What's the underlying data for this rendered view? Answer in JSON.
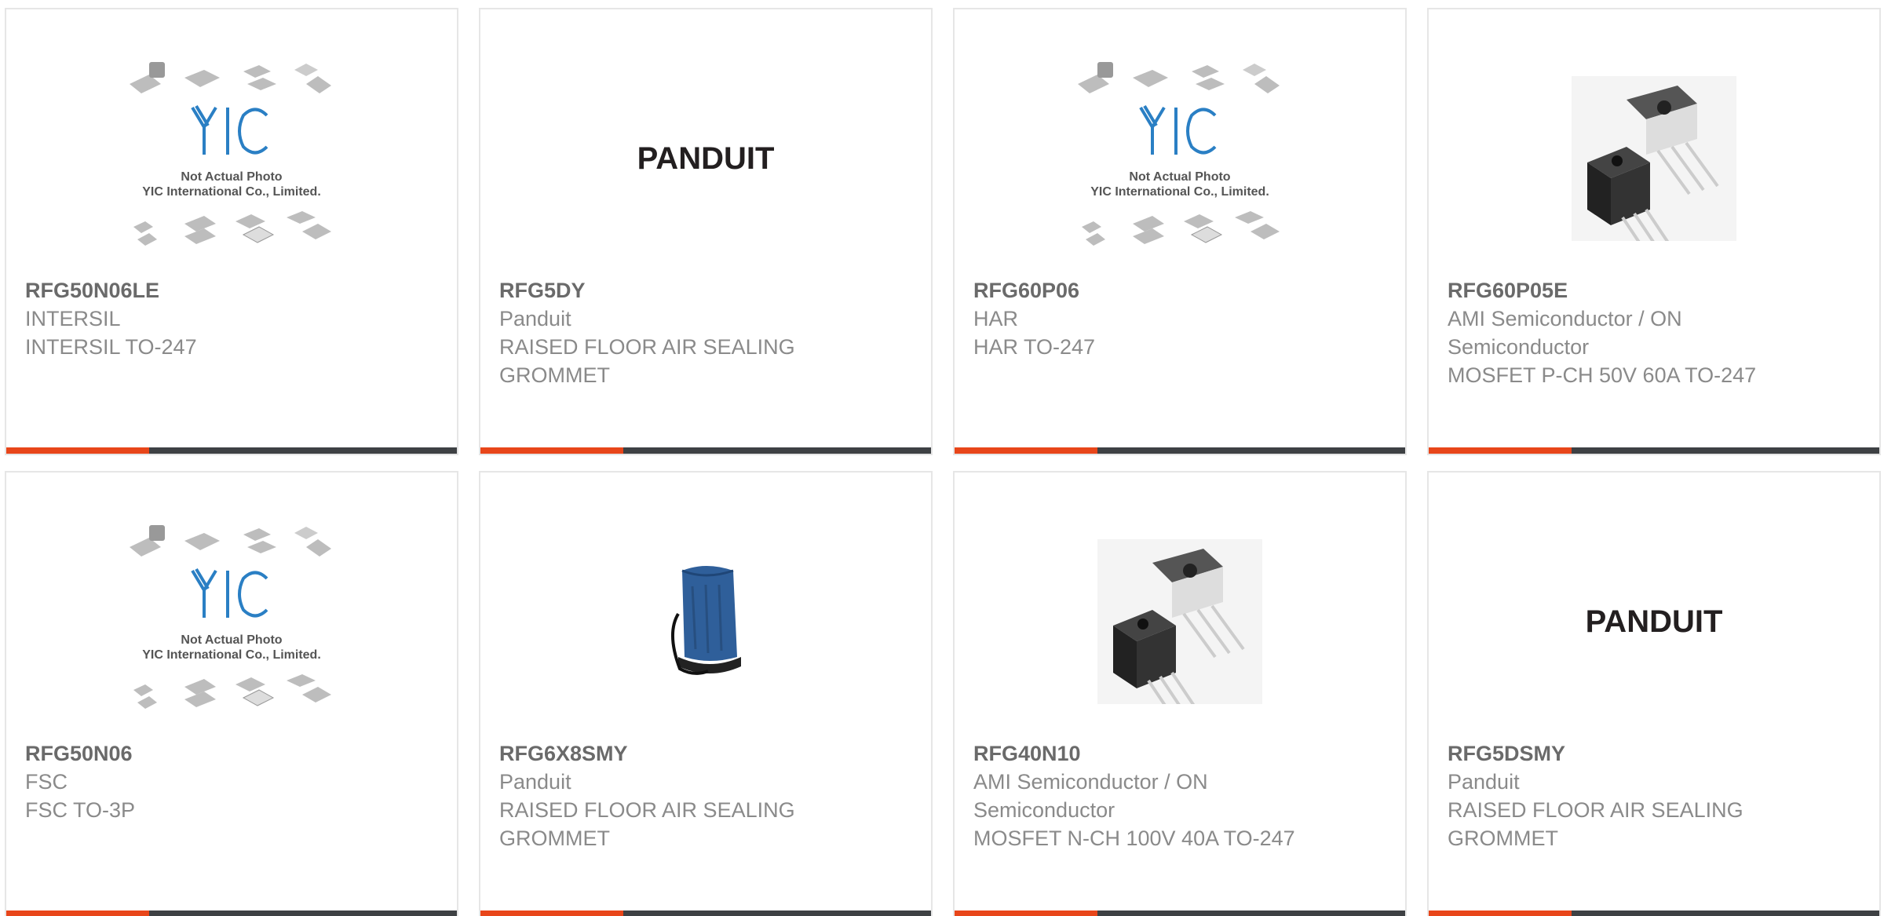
{
  "products": [
    {
      "part_number": "RFG50N06LE",
      "manufacturer": "INTERSIL",
      "description": "INTERSIL TO-247",
      "image": "yic-placeholder",
      "image_caption_1": "Not Actual Photo",
      "image_caption_2": "YIC International Co., Limited."
    },
    {
      "part_number": "RFG5DY",
      "manufacturer": "Panduit",
      "description": "RAISED FLOOR AIR SEALING GROMMET",
      "image": "panduit-logo",
      "logo_text": "PANDUIT"
    },
    {
      "part_number": "RFG60P06",
      "manufacturer": "HAR",
      "description": "HAR TO-247",
      "image": "yic-placeholder",
      "image_caption_1": "Not Actual Photo",
      "image_caption_2": "YIC International Co., Limited."
    },
    {
      "part_number": "RFG60P05E",
      "manufacturer": "AMI Semiconductor / ON Semiconductor",
      "description": "MOSFET P-CH 50V 60A TO-247",
      "image": "to247-photo"
    },
    {
      "part_number": "RFG50N06",
      "manufacturer": "FSC",
      "description": "FSC TO-3P",
      "image": "yic-placeholder",
      "image_caption_1": "Not Actual Photo",
      "image_caption_2": "YIC International Co., Limited."
    },
    {
      "part_number": "RFG6X8SMY",
      "manufacturer": "Panduit",
      "description": "RAISED FLOOR AIR SEALING GROMMET",
      "image": "grommet-photo"
    },
    {
      "part_number": "RFG40N10",
      "manufacturer": "AMI Semiconductor / ON Semiconductor",
      "description": "MOSFET N-CH 100V 40A TO-247",
      "image": "to247-photo"
    },
    {
      "part_number": "RFG5DSMY",
      "manufacturer": "Panduit",
      "description": "RAISED FLOOR AIR SEALING GROMMET",
      "image": "panduit-logo",
      "logo_text": "PANDUIT"
    }
  ],
  "colors": {
    "accent": "#e8461a",
    "bar": "#3e4144",
    "border": "#e6e6e6",
    "text": "#8a8a8a",
    "part_number": "#6a6a6a",
    "yic_blue": "#2a7fc4"
  }
}
